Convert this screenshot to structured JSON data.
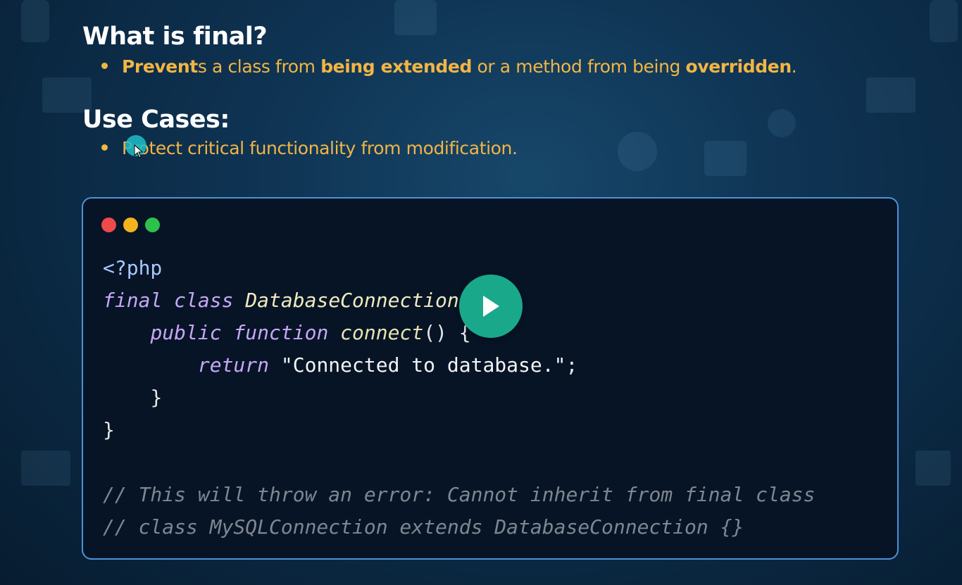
{
  "slide": {
    "heading_1": "What is final?",
    "bullet_1": {
      "part_a_bold": "Prevent",
      "part_b": "s a class from ",
      "part_c_bold": "being extended",
      "part_d": " or a method from being ",
      "part_e_bold": "overridden",
      "part_f": "."
    },
    "heading_2": "Use Cases:",
    "bullet_2": "Protect critical functionality from modification."
  },
  "code_window": {
    "lines": {
      "l1_tag": "<?php",
      "l2_kw1": "final",
      "l2_kw2": "class",
      "l2_name": "DatabaseConnection",
      "l2_brace": " {",
      "l3_kw1": "public",
      "l3_kw2": "function",
      "l3_name": "connect",
      "l3_rest": "() {",
      "l4_kw": "return",
      "l4_str": "\"Connected to database.\"",
      "l4_semi": ";",
      "l5": "}",
      "l6": "}",
      "c1": "// This will throw an error: Cannot inherit from final class",
      "c2": "// class MySQLConnection extends DatabaseConnection {}"
    }
  },
  "colors": {
    "accent_bullet": "#f2b544",
    "play_button": "#19a98a",
    "window_border": "#4e92d6"
  },
  "icons": [
    "play-icon",
    "cursor-icon"
  ]
}
